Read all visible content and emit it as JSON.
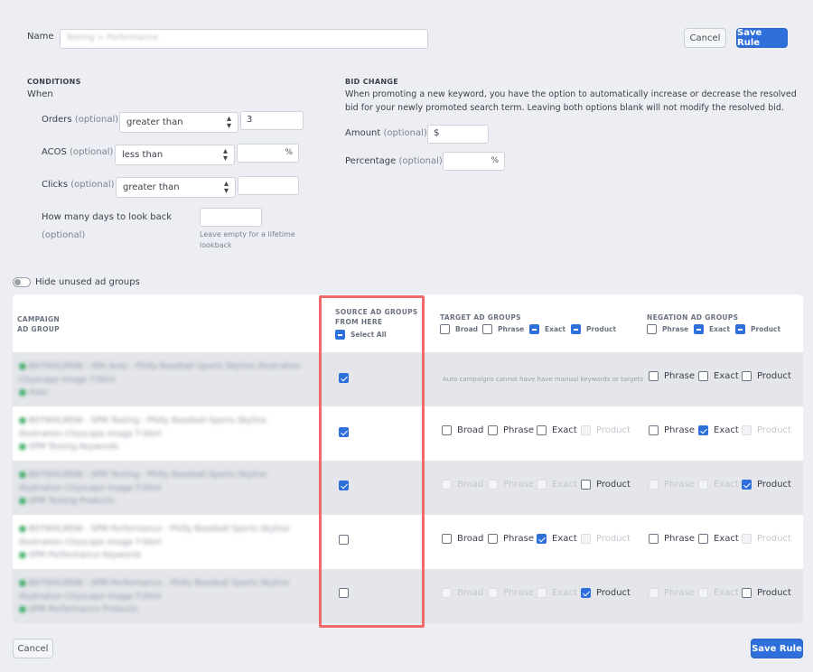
{
  "name": {
    "label": "Name",
    "value": "Testing > Performance"
  },
  "header": {
    "cancel_label": "Cancel",
    "save_label": "Save Rule"
  },
  "conditions": {
    "title": "CONDITIONS",
    "when": "When",
    "optional": "(optional)",
    "orders": {
      "label": "Orders",
      "operator": "greater than",
      "value": "3"
    },
    "acos": {
      "label": "ACOS",
      "operator": "less than",
      "value": "",
      "unit": "%"
    },
    "clicks": {
      "label": "Clicks",
      "operator": "greater than",
      "value": ""
    },
    "lookback": {
      "label": "How many days to look back",
      "optional": "(optional)",
      "value": "",
      "hint_line1": "Leave empty for a lifetime",
      "hint_line2": "lookback"
    }
  },
  "bid_change": {
    "title": "BID CHANGE",
    "description_line1": "When promoting a new keyword, you have the option to automatically increase or decrease the resolved",
    "description_line2": "bid for your newly promoted search term. Leaving both options blank will not modify the resolved bid.",
    "amount": {
      "label": "Amount",
      "optional": "(optional)",
      "prefix": "$",
      "value": ""
    },
    "percentage": {
      "label": "Percentage",
      "optional": "(optional)",
      "unit": "%",
      "value": ""
    }
  },
  "hide_unused": {
    "label": "Hide unused ad groups",
    "enabled": false
  },
  "table": {
    "col_campaign_line1": "CAMPAIGN",
    "col_campaign_line2": "AD GROUP",
    "col_source_line1": "SOURCE AD GROUPS",
    "col_source_line2": "FROM HERE",
    "select_all": "Select All",
    "col_target": "TARGET AD GROUPS",
    "col_negation": "NEGATION AD GROUPS",
    "target_header_options": [
      "Broad",
      "Phrase",
      "Exact",
      "Product"
    ],
    "negation_header_options": [
      "Phrase",
      "Exact",
      "Product"
    ],
    "auto_note": "Auto campaigns cannot have have manual keywords or targets",
    "rows": [
      {
        "campaign_1": "B07WXLMSW - SPA Auto - Philly Baseball Sports Skyline Illustration",
        "campaign_2": "Cityscape Image T-Shirt",
        "ad_group": "Auto",
        "source": true
      },
      {
        "campaign_1": "B07WXLMSW - SPM Testing - Philly Baseball Sports Skyline",
        "campaign_2": "Illustration Cityscape Image T-Shirt",
        "ad_group": "SPM Testing Keywords",
        "source": true
      },
      {
        "campaign_1": "B07WXLMSW - SPM Testing - Philly Baseball Sports Skyline",
        "campaign_2": "Illustration Cityscape Image T-Shirt",
        "ad_group": "SPM Testing Products",
        "source": true
      },
      {
        "campaign_1": "B07WXLMSW - SPM Performance - Philly Baseball Sports Skyline",
        "campaign_2": "Illustration Cityscape Image T-Shirt",
        "ad_group": "SPM Performance Keywords",
        "source": false
      },
      {
        "campaign_1": "B07WXLMSW - SPM Performance - Philly Baseball Sports Skyline",
        "campaign_2": "Illustration Cityscape Image T-Shirt",
        "ad_group": "SPM Performance Products",
        "source": false
      }
    ],
    "options": {
      "broad": "Broad",
      "phrase": "Phrase",
      "exact": "Exact",
      "product": "Product"
    }
  },
  "footer": {
    "cancel_label": "Cancel",
    "save_label": "Save Rule"
  },
  "colors": {
    "primary": "#2f6fdc",
    "highlight": "#f0696b",
    "dot": "#1e9e4a"
  }
}
